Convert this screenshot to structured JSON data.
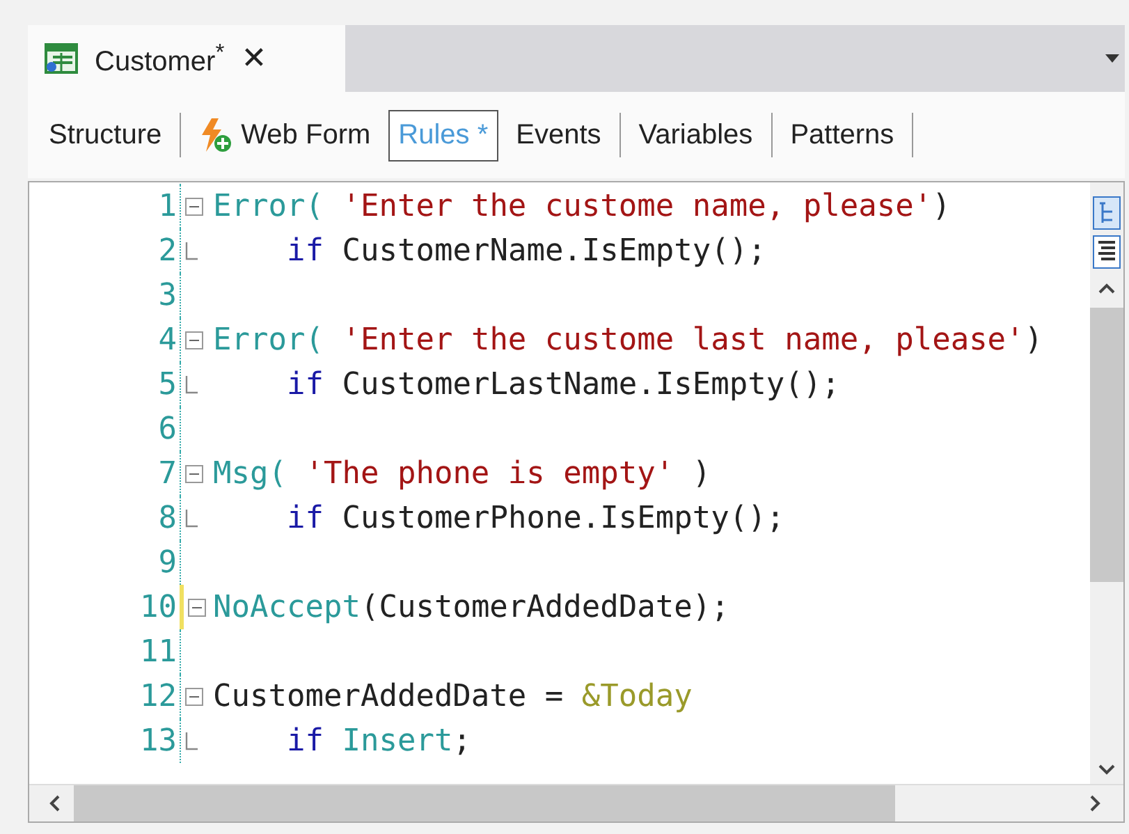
{
  "document_tab": {
    "label": "Customer$^{*}$",
    "close": "✕"
  },
  "subtabs": [
    {
      "label": "Structure",
      "selected": false,
      "kind": "plain"
    },
    {
      "label": "Web Form",
      "selected": false,
      "kind": "icon"
    },
    {
      "label": "Rules *",
      "selected": true,
      "kind": "plain"
    },
    {
      "label": "Events",
      "selected": false,
      "kind": "plain"
    },
    {
      "label": "Variables",
      "selected": false,
      "kind": "plain"
    },
    {
      "label": "Patterns",
      "selected": false,
      "kind": "plain"
    }
  ],
  "lines": [
    {
      "number": "1",
      "kind": "fold-start",
      "indent": false,
      "changed": false,
      "tokens": [
        {
          "kind": "func",
          "text": "Error("
        },
        {
          "kind": "string",
          "text": " 'Enter the custome name, please'"
        },
        {
          "kind": "ident",
          "text": ")"
        }
      ]
    },
    {
      "number": "2",
      "kind": "fold-end",
      "indent": true,
      "changed": false,
      "tokens": [
        {
          "kind": "keyword",
          "text": "if"
        },
        {
          "kind": "ident",
          "text": " CustomerName.IsEmpty();"
        }
      ]
    },
    {
      "number": "3",
      "kind": "blank",
      "changed": false
    },
    {
      "number": "4",
      "kind": "fold-start",
      "indent": false,
      "changed": false,
      "tokens": [
        {
          "kind": "func",
          "text": "Error("
        },
        {
          "kind": "string",
          "text": " 'Enter the custome last name, please'"
        },
        {
          "kind": "ident",
          "text": ")"
        }
      ]
    },
    {
      "number": "5",
      "kind": "fold-end",
      "indent": true,
      "changed": false,
      "tokens": [
        {
          "kind": "keyword",
          "text": "if"
        },
        {
          "kind": "ident",
          "text": " CustomerLastName.IsEmpty();"
        }
      ]
    },
    {
      "number": "6",
      "kind": "blank",
      "changed": false
    },
    {
      "number": "7",
      "kind": "fold-start",
      "indent": false,
      "changed": false,
      "tokens": [
        {
          "kind": "func",
          "text": "Msg("
        },
        {
          "kind": "string",
          "text": " 'The phone is empty' "
        },
        {
          "kind": "ident",
          "text": ")"
        }
      ]
    },
    {
      "number": "8",
      "kind": "fold-end",
      "indent": true,
      "changed": false,
      "tokens": [
        {
          "kind": "keyword",
          "text": "if"
        },
        {
          "kind": "ident",
          "text": " CustomerPhone.IsEmpty();"
        }
      ]
    },
    {
      "number": "9",
      "kind": "blank",
      "changed": false
    },
    {
      "number": "10",
      "kind": "fold-start",
      "indent": false,
      "changed": true,
      "tokens": [
        {
          "kind": "func",
          "text": "NoAccept"
        },
        {
          "kind": "ident",
          "text": "(CustomerAddedDate);"
        }
      ]
    },
    {
      "number": "11",
      "kind": "blank",
      "changed": false
    },
    {
      "number": "12",
      "kind": "fold-start",
      "indent": false,
      "changed": false,
      "tokens": [
        {
          "kind": "ident",
          "text": "CustomerAddedDate = "
        },
        {
          "kind": "variable",
          "text": "&Today"
        }
      ]
    },
    {
      "number": "13",
      "kind": "fold-end",
      "indent": true,
      "changed": false,
      "tokens": [
        {
          "kind": "keyword",
          "text": "if"
        },
        {
          "kind": "func",
          "text": " Insert"
        },
        {
          "kind": "ident",
          "text": ";"
        }
      ]
    }
  ]
}
